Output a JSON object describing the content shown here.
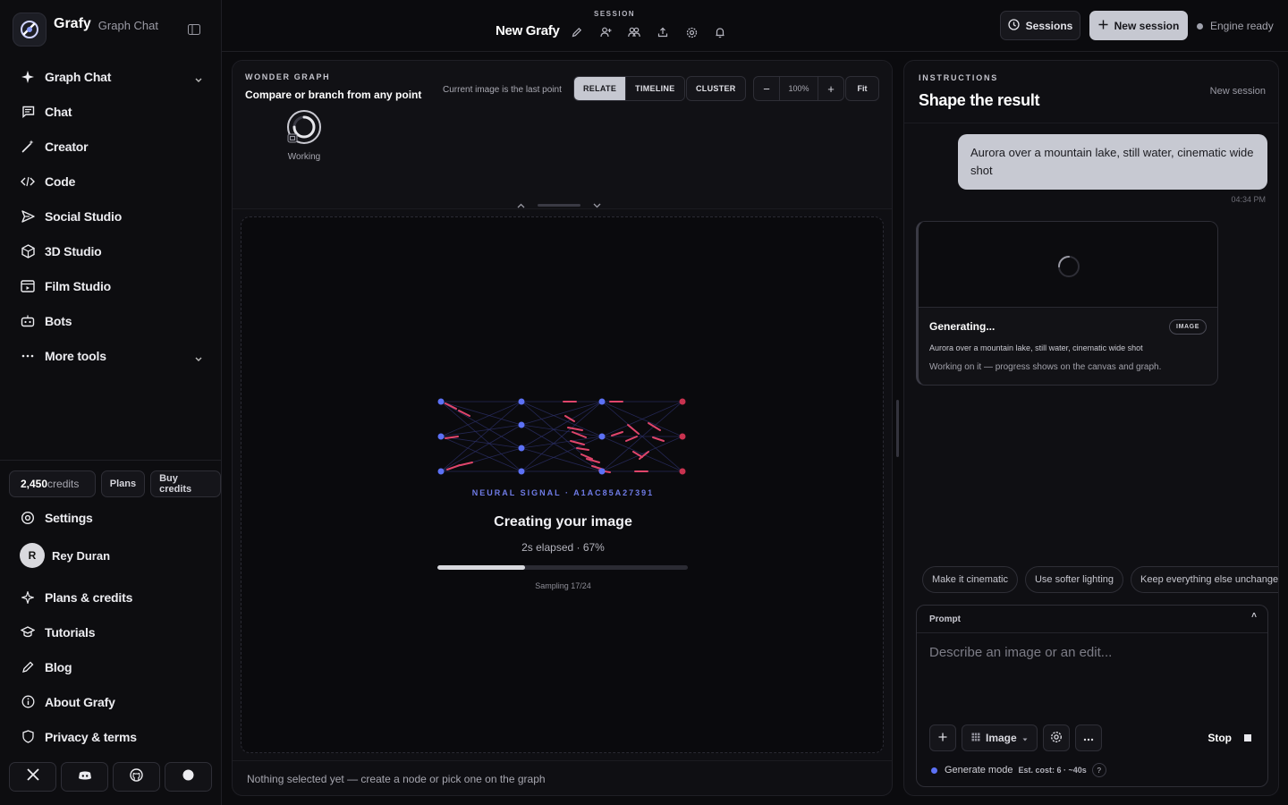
{
  "sidebar": {
    "brand_name": "Grafy",
    "brand_sub": "Graph Chat",
    "nav": [
      {
        "label": "Graph Chat",
        "icon": "sparkle-icon"
      },
      {
        "label": "Chat",
        "icon": "message-icon"
      },
      {
        "label": "Creator",
        "icon": "magic-wand-icon"
      },
      {
        "label": "Code",
        "icon": "code-icon"
      },
      {
        "label": "Social Studio",
        "icon": "send-icon"
      },
      {
        "label": "3D Studio",
        "icon": "cube-icon"
      },
      {
        "label": "Film Studio",
        "icon": "film-icon"
      },
      {
        "label": "Bots",
        "icon": "bot-icon"
      },
      {
        "label": "More tools",
        "icon": "ellipsis-icon"
      }
    ],
    "credits_value": "2,450",
    "credits_unit": "credits",
    "plans_label": "Plans",
    "buy_credits_label": "Buy credits",
    "settings_label": "Settings",
    "user_initial": "R",
    "user_name": "Rey Duran",
    "nav2": [
      {
        "label": "Plans & credits",
        "icon": "sparkle-outline-icon"
      },
      {
        "label": "Tutorials",
        "icon": "graduation-cap-icon"
      },
      {
        "label": "Blog",
        "icon": "pen-icon"
      },
      {
        "label": "About Grafy",
        "icon": "info-icon"
      },
      {
        "label": "Privacy & terms",
        "icon": "shield-icon"
      }
    ]
  },
  "topbar": {
    "session_label": "SESSION",
    "session_title": "New Grafy",
    "sessions_label": "Sessions",
    "new_session_label": "New session",
    "engine_status": "Engine ready"
  },
  "graph": {
    "eyebrow": "WONDER GRAPH",
    "title": "Compare or branch from any point",
    "note": "Current image is the last point",
    "relate_label": "RELATE",
    "timeline_label": "TIMELINE",
    "cluster_label": "CLUSTER",
    "zoom_minus": "−",
    "zoom_value": "100%",
    "zoom_plus": "+",
    "fit_label": "Fit",
    "node_label": "Working",
    "signal_caption": "NEURAL SIGNAL · A1AC85A27391",
    "gen_title": "Creating your image",
    "gen_elapsed": "2s elapsed · 67%",
    "progress": 0.35,
    "gen_step": "Sampling 17/24",
    "status_footer": "Nothing selected yet — create a node or pick one on the graph"
  },
  "instructions": {
    "eyebrow": "INSTRUCTIONS",
    "title": "Shape the result",
    "new_session": "New session",
    "user_message": "Aurora over a mountain lake, still water, cinematic wide shot",
    "message_time": "04:34 PM",
    "card_title": "Generating...",
    "card_badge": "IMAGE",
    "card_prompt": "Aurora over a mountain lake, still water, cinematic wide shot",
    "card_status": "Working on it — progress shows on the canvas and graph.",
    "chips": [
      "Make it cinematic",
      "Use softer lighting",
      "Keep everything else unchanged"
    ],
    "prompt_label": "Prompt",
    "prompt_placeholder": "Describe an image or an edit...",
    "mode_label": "Image",
    "stop_label": "Stop",
    "gen_mode": "Generate mode",
    "est_cost": "Est. cost: 6 · ~40s",
    "help": "?"
  },
  "colors": {
    "accent_blue": "#5c71f5",
    "signal_red": "#e0456b",
    "node_red": "#c8324f"
  }
}
